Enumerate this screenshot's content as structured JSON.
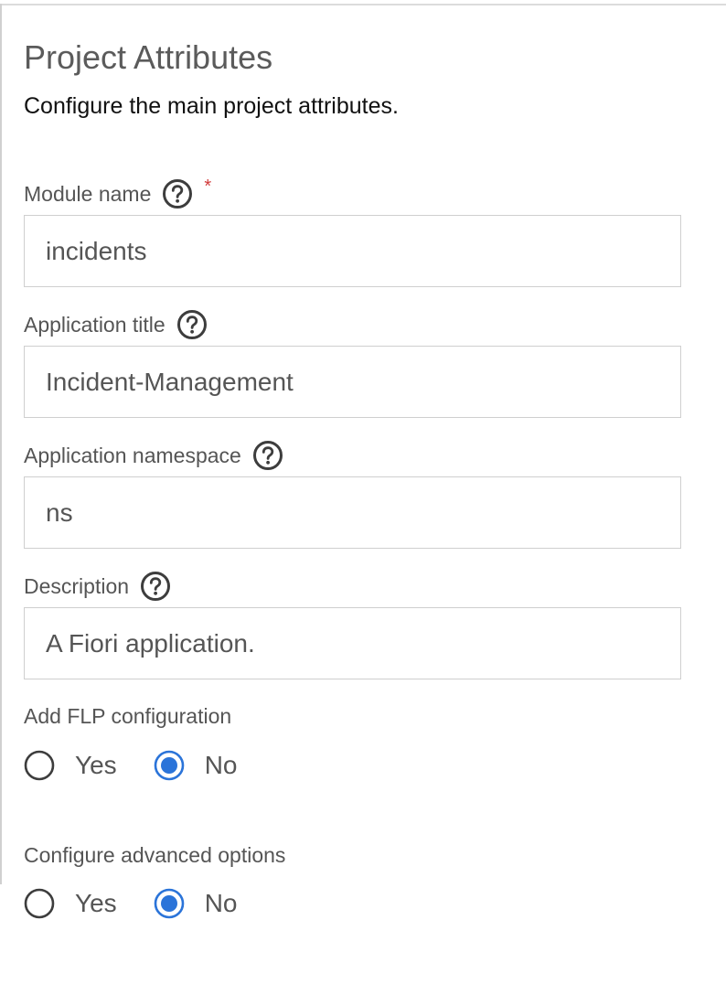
{
  "panel": {
    "title": "Project Attributes",
    "subtitle": "Configure the main project attributes."
  },
  "fields": {
    "module_name": {
      "label": "Module name",
      "required_marker": "*",
      "value": "incidents",
      "help_icon": "question-circle-icon"
    },
    "app_title": {
      "label": "Application title",
      "value": "Incident-Management",
      "help_icon": "question-circle-icon"
    },
    "app_namespace": {
      "label": "Application namespace",
      "value": "ns",
      "help_icon": "question-circle-icon"
    },
    "description": {
      "label": "Description",
      "value": "A Fiori application.",
      "help_icon": "question-circle-icon"
    }
  },
  "flp": {
    "label": "Add FLP configuration",
    "options": [
      "Yes",
      "No"
    ],
    "selected": "No"
  },
  "advanced": {
    "label": "Configure advanced options",
    "options": [
      "Yes",
      "No"
    ],
    "selected": "No"
  },
  "colors": {
    "accent": "#2b74d9",
    "required": "#d23b3b",
    "border": "#cfcfcf"
  }
}
